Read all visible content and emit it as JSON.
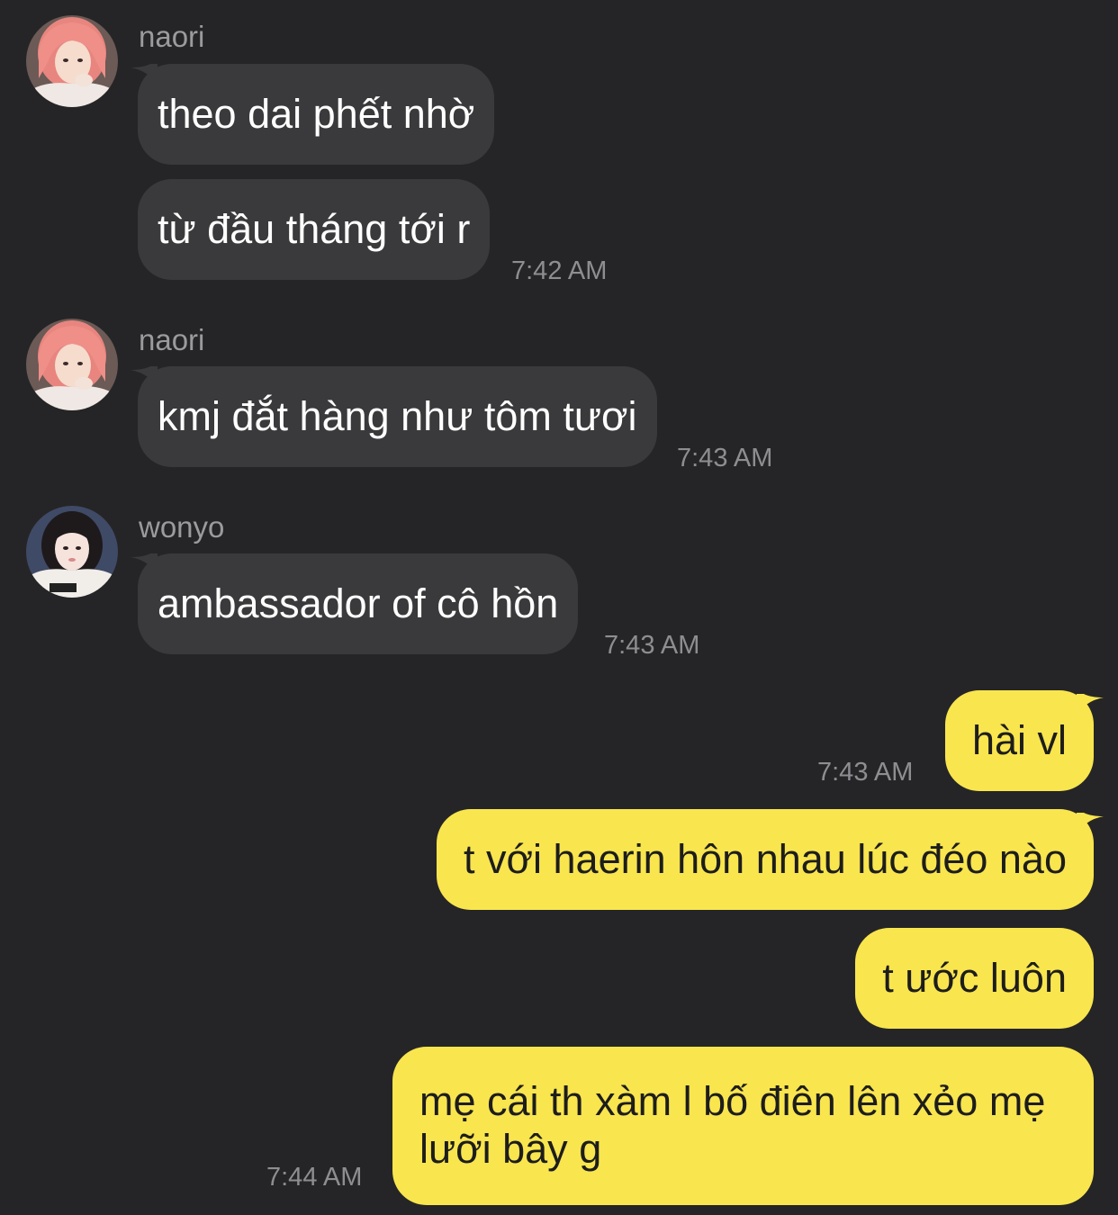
{
  "messages": [
    {
      "sender": "naori",
      "text": "theo dai phết nhờ",
      "direction": "incoming"
    },
    {
      "sender": "naori",
      "text": "từ đầu tháng tới r",
      "direction": "incoming",
      "time": "7:42 AM"
    },
    {
      "sender": "naori",
      "text": "kmj đắt hàng như tôm tươi",
      "direction": "incoming",
      "time": "7:43 AM"
    },
    {
      "sender": "wonyo",
      "text": "ambassador of cô hồn",
      "direction": "incoming",
      "time": "7:43 AM"
    },
    {
      "text": "hài vl",
      "direction": "outgoing",
      "time": "7:43 AM"
    },
    {
      "text": "t với haerin hôn nhau lúc đéo nào",
      "direction": "outgoing"
    },
    {
      "text": "t ước luôn",
      "direction": "outgoing"
    },
    {
      "text": "mẹ cái th xàm l bố điên lên xẻo mẹ lưỡi bây g",
      "direction": "outgoing",
      "time": "7:44 AM"
    }
  ],
  "colors": {
    "background": "#252527",
    "incoming_bubble": "#3a3a3c",
    "outgoing_bubble": "#f9e54e",
    "incoming_text": "#ffffff",
    "outgoing_text": "#1d1d1d",
    "meta_text": "#8e8e91"
  },
  "avatars": {
    "naori": "pink-hair-avatar",
    "wonyo": "dark-hair-avatar"
  }
}
